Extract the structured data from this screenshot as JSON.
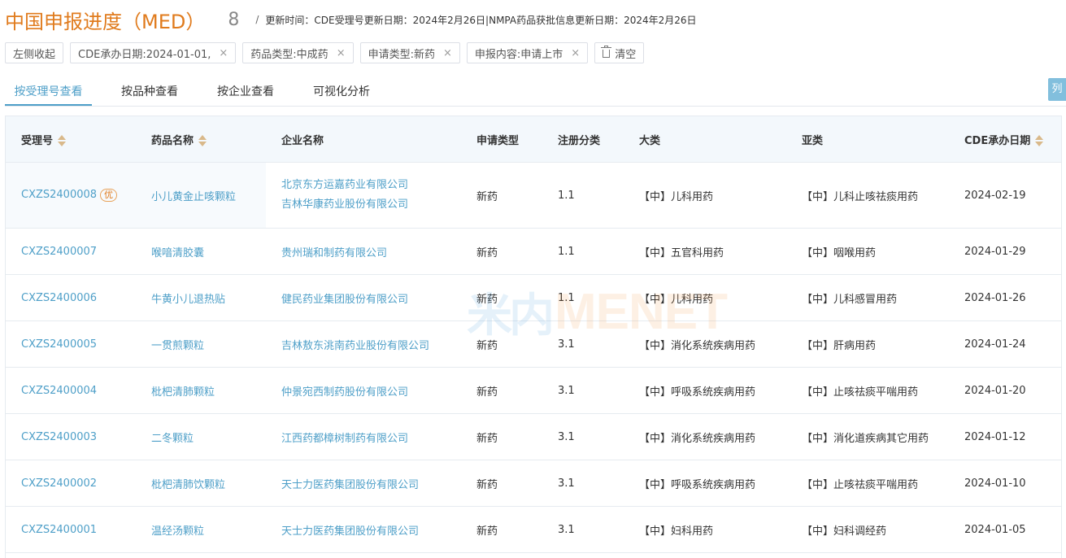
{
  "header": {
    "title": "中国申报进度（MED）",
    "count": "8",
    "separator": "/",
    "update_info": "更新时间：CDE受理号更新日期：2024年2月26日|NMPA药品获批信息更新日期：2024年2月26日"
  },
  "filters": {
    "collapse_label": "左侧收起",
    "chips": [
      {
        "label": "CDE承办日期:2024-01-01,"
      },
      {
        "label": "药品类型:中成药"
      },
      {
        "label": "申请类型:新药"
      },
      {
        "label": "申报内容:申请上市"
      }
    ],
    "close_glyph": "×",
    "clear_label": "清空"
  },
  "tabs": [
    {
      "label": "按受理号查看",
      "active": true
    },
    {
      "label": "按品种查看"
    },
    {
      "label": "按企业查看"
    },
    {
      "label": "可视化分析"
    }
  ],
  "side_button_label": "列",
  "table": {
    "columns": [
      "受理号",
      "药品名称",
      "企业名称",
      "申请类型",
      "注册分类",
      "大类",
      "亚类",
      "CDE承办日期"
    ],
    "priority_badge": "优",
    "rows": [
      {
        "id": "CXZS2400008",
        "drug": "小儿黄金止咳颗粒",
        "companies": [
          "北京东方运嘉药业有限公司",
          "吉林华康药业股份有限公司"
        ],
        "type": "新药",
        "reg": "1.1",
        "major": "【中】儿科用药",
        "minor": "【中】儿科止咳祛痰用药",
        "date": "2024-02-19"
      },
      {
        "id": "CXZS2400007",
        "drug": "喉喑清胶囊",
        "companies": [
          "贵州瑞和制药有限公司"
        ],
        "type": "新药",
        "reg": "1.1",
        "major": "【中】五官科用药",
        "minor": "【中】咽喉用药",
        "date": "2024-01-29"
      },
      {
        "id": "CXZS2400006",
        "drug": "牛黄小儿退热贴",
        "companies": [
          "健民药业集团股份有限公司"
        ],
        "type": "新药",
        "reg": "1.1",
        "major": "【中】儿科用药",
        "minor": "【中】儿科感冒用药",
        "date": "2024-01-26"
      },
      {
        "id": "CXZS2400005",
        "drug": "一贯煎颗粒",
        "companies": [
          "吉林敖东洮南药业股份有限公司"
        ],
        "type": "新药",
        "reg": "3.1",
        "major": "【中】消化系统疾病用药",
        "minor": "【中】肝病用药",
        "date": "2024-01-24"
      },
      {
        "id": "CXZS2400004",
        "drug": "枇杷清肺颗粒",
        "companies": [
          "仲景宛西制药股份有限公司"
        ],
        "type": "新药",
        "reg": "3.1",
        "major": "【中】呼吸系统疾病用药",
        "minor": "【中】止咳祛痰平喘用药",
        "date": "2024-01-20"
      },
      {
        "id": "CXZS2400003",
        "drug": "二冬颗粒",
        "companies": [
          "江西药都樟树制药有限公司"
        ],
        "type": "新药",
        "reg": "3.1",
        "major": "【中】消化系统疾病用药",
        "minor": "【中】消化道疾病其它用药",
        "date": "2024-01-12"
      },
      {
        "id": "CXZS2400002",
        "drug": "枇杷清肺饮颗粒",
        "companies": [
          "天士力医药集团股份有限公司"
        ],
        "type": "新药",
        "reg": "3.1",
        "major": "【中】呼吸系统疾病用药",
        "minor": "【中】止咳祛痰平喘用药",
        "date": "2024-01-10"
      },
      {
        "id": "CXZS2400001",
        "drug": "温经汤颗粒",
        "companies": [
          "天士力医药集团股份有限公司"
        ],
        "type": "新药",
        "reg": "3.1",
        "major": "【中】妇科用药",
        "minor": "【中】妇科调经药",
        "date": "2024-01-05"
      }
    ]
  },
  "watermark": {
    "cn": "米内",
    "en": "MENET"
  }
}
